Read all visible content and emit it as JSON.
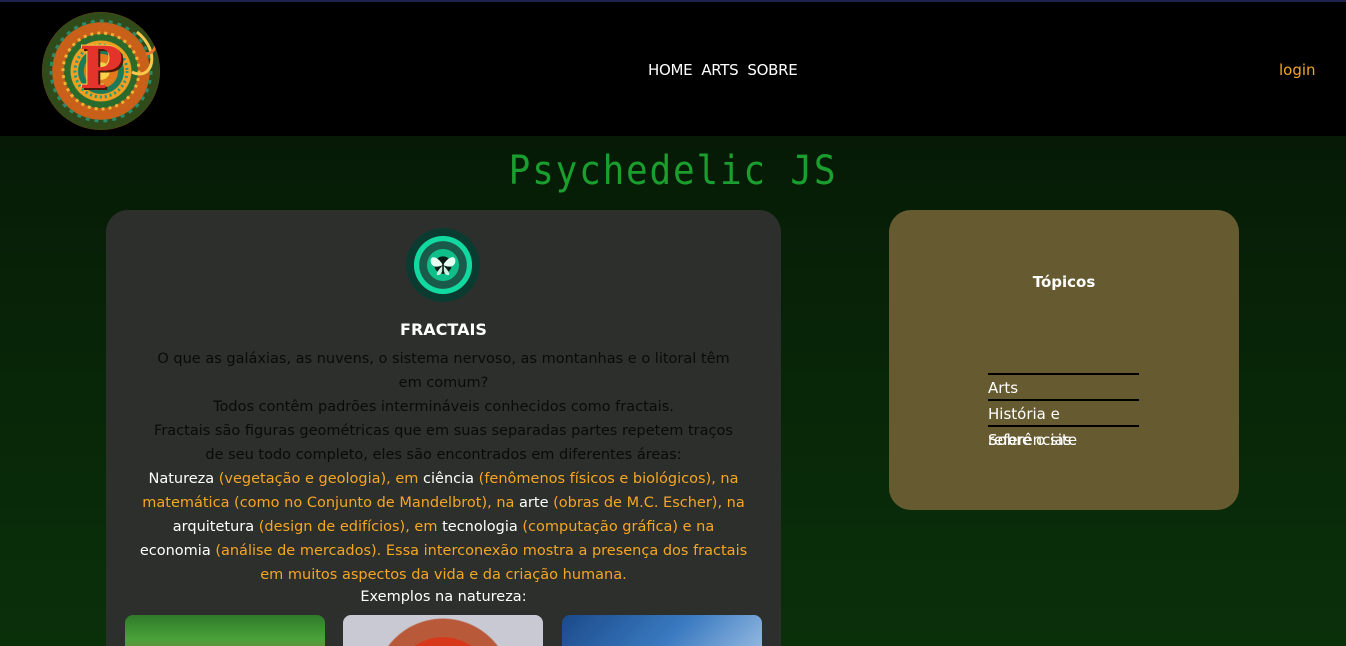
{
  "header": {
    "logo_letter": "P",
    "nav": [
      "HOME",
      "ARTS",
      "SOBRE"
    ],
    "login_label": "login"
  },
  "site_title": "Psychedelic JS",
  "main": {
    "title": "FRACTAIS",
    "intro_lines": [
      "O que as galáxias, as nuvens, o sistema nervoso, as montanhas e o litoral têm em comum?",
      "Todos contêm padrões intermináveis conhecidos como fractais.",
      "Fractais são figuras geométricas que em suas separadas partes repetem traços de seu todo completo, eles são encontrados em diferentes áreas:"
    ],
    "areas": {
      "natureza": "Natureza",
      "natureza_desc": " (vegetação e geologia), em ",
      "ciencia": "ciência",
      "ciencia_desc": " (fenômenos físicos e biológicos), na matemática (como no Conjunto de Mandelbrot), na ",
      "arte": "arte",
      "arte_desc": " (obras de M.C. Escher), na ",
      "arquitetura": "arquitetura",
      "arquitetura_desc": " (design de edifícios), em ",
      "tecnologia": "tecnologia",
      "tecnologia_desc": " (computação gráfica) e na ",
      "economia": "economia",
      "economia_desc": " (análise de mercados). Essa interconexão mostra a presença dos fractais em muitos aspectos da vida e da criação humana."
    },
    "examples_label": "Exemplos na natureza:"
  },
  "sidebar": {
    "title": "Tópicos",
    "topics": [
      "Arts",
      "História e referências",
      "Sobre o site"
    ]
  },
  "colors": {
    "accent_orange": "#f5a623",
    "title_green": "#1a9e2e",
    "card_dark": "#2c2f2c",
    "card_olive": "#665b30"
  }
}
